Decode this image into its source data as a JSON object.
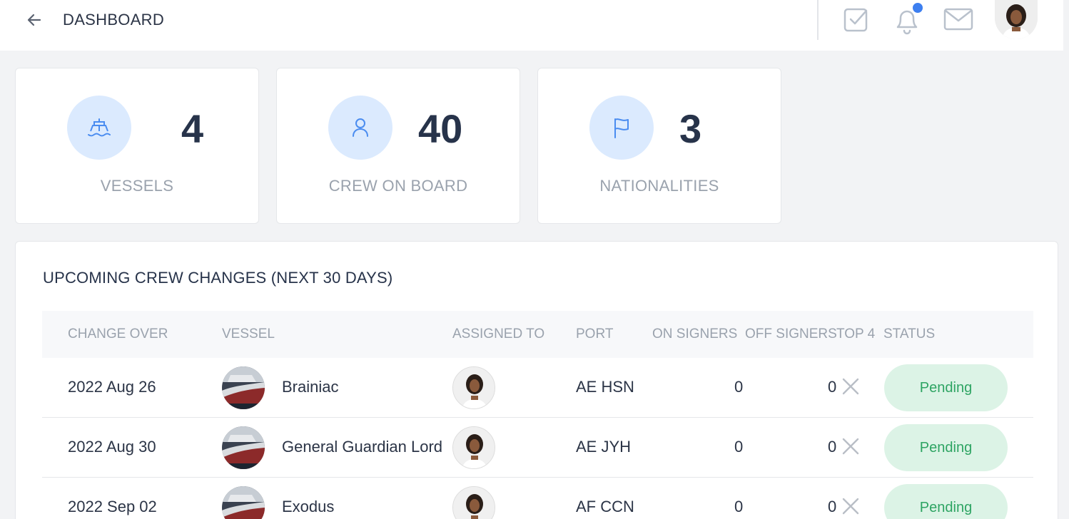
{
  "header": {
    "title": "DASHBOARD",
    "icons": [
      "arrow-left-icon",
      "task-check-icon",
      "bell-icon",
      "mail-icon"
    ],
    "notification_dot_color": "#3d7ff0"
  },
  "stats": [
    {
      "icon": "ship-icon",
      "value": "4",
      "label": "VESSELS"
    },
    {
      "icon": "user-icon",
      "value": "40",
      "label": "CREW ON BOARD"
    },
    {
      "icon": "flag-icon",
      "value": "3",
      "label": "NATIONALITIES"
    }
  ],
  "crew_changes": {
    "title": "UPCOMING CREW CHANGES (NEXT 30 DAYS)",
    "columns": [
      "CHANGE OVER",
      "VESSEL",
      "ASSIGNED TO",
      "PORT",
      "ON SIGNERS",
      "OFF SIGNERS",
      "TOP 4",
      "STATUS"
    ],
    "rows": [
      {
        "change_over": "2022 Aug 26",
        "vessel": "Brainiac",
        "port": "AE HSN",
        "on_signers": "0",
        "off_signers": "0",
        "status": "Pending"
      },
      {
        "change_over": "2022 Aug 30",
        "vessel": "General Guardian Lord",
        "port": "AE JYH",
        "on_signers": "0",
        "off_signers": "0",
        "status": "Pending"
      },
      {
        "change_over": "2022 Sep 02",
        "vessel": "Exodus",
        "port": "AF CCN",
        "on_signers": "0",
        "off_signers": "0",
        "status": "Pending"
      }
    ]
  },
  "colors": {
    "accent": "#3d7ff0",
    "icon_circle": "#dbeafe",
    "status_bg": "#dcf3e6",
    "status_text": "#2ea463"
  }
}
